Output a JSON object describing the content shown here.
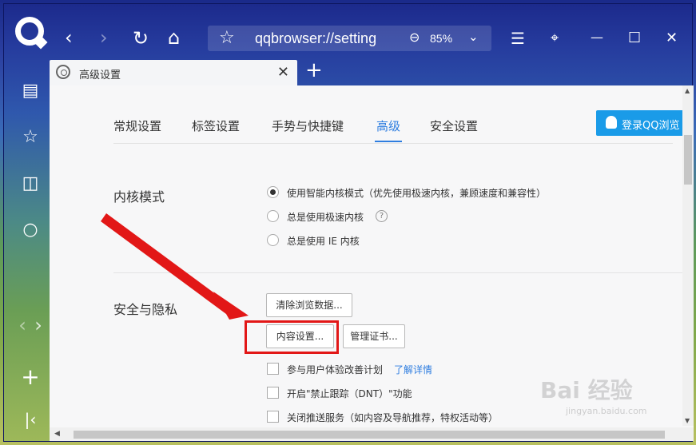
{
  "window": {
    "back_icon": "‹",
    "forward_icon": "›",
    "refresh_icon": "↻",
    "home_icon": "⌂",
    "menu_icon": "☰",
    "skin_icon": "⌖",
    "minimize_icon": "—",
    "maximize_icon": "☐",
    "close_icon": "✕"
  },
  "address_bar": {
    "favorite_icon": "☆",
    "url": "qqbrowser://setting",
    "zoom_icon": "⊖",
    "zoom": "85%",
    "dropdown_icon": "⌄"
  },
  "sidebar": {
    "items": [
      {
        "name": "news-icon",
        "glyph": "▤"
      },
      {
        "name": "star-icon",
        "glyph": "☆"
      },
      {
        "name": "book-icon",
        "glyph": "◫"
      },
      {
        "name": "search-icon",
        "glyph": "○"
      }
    ],
    "nav_left": "‹",
    "nav_right": "›",
    "add": "+",
    "collapse": "|‹"
  },
  "tab": {
    "title": "高级设置",
    "close": "✕",
    "new_tab": "+"
  },
  "settings_nav": {
    "items": [
      "常规设置",
      "标签设置",
      "手势与快捷键",
      "高级",
      "安全设置"
    ],
    "active": "高级",
    "login_label": "登录QQ浏览"
  },
  "kernel_section": {
    "title": "内核模式",
    "options": [
      {
        "label": "使用智能内核模式（优先使用极速内核，兼顾速度和兼容性）",
        "selected": true
      },
      {
        "label": "总是使用极速内核",
        "selected": false
      },
      {
        "label": "总是使用 IE 内核",
        "selected": false
      }
    ],
    "help_glyph": "?"
  },
  "privacy_section": {
    "title": "安全与隐私",
    "clear_button": "清除浏览数据...",
    "content_button": "内容设置...",
    "cert_button": "管理证书...",
    "checkboxes": [
      {
        "label": "参与用户体验改善计划",
        "link": "了解详情"
      },
      {
        "label": "开启\"禁止跟踪（DNT）\"功能"
      },
      {
        "label": "关闭推送服务（如内容及导航推荐，特权活动等）"
      }
    ]
  },
  "watermark": {
    "main": "Bai 经验",
    "sub": "jingyan.baidu.com"
  },
  "colors": {
    "accent": "#2f7ee0",
    "login_bg": "#1a9be8",
    "highlight": "#e21717"
  }
}
